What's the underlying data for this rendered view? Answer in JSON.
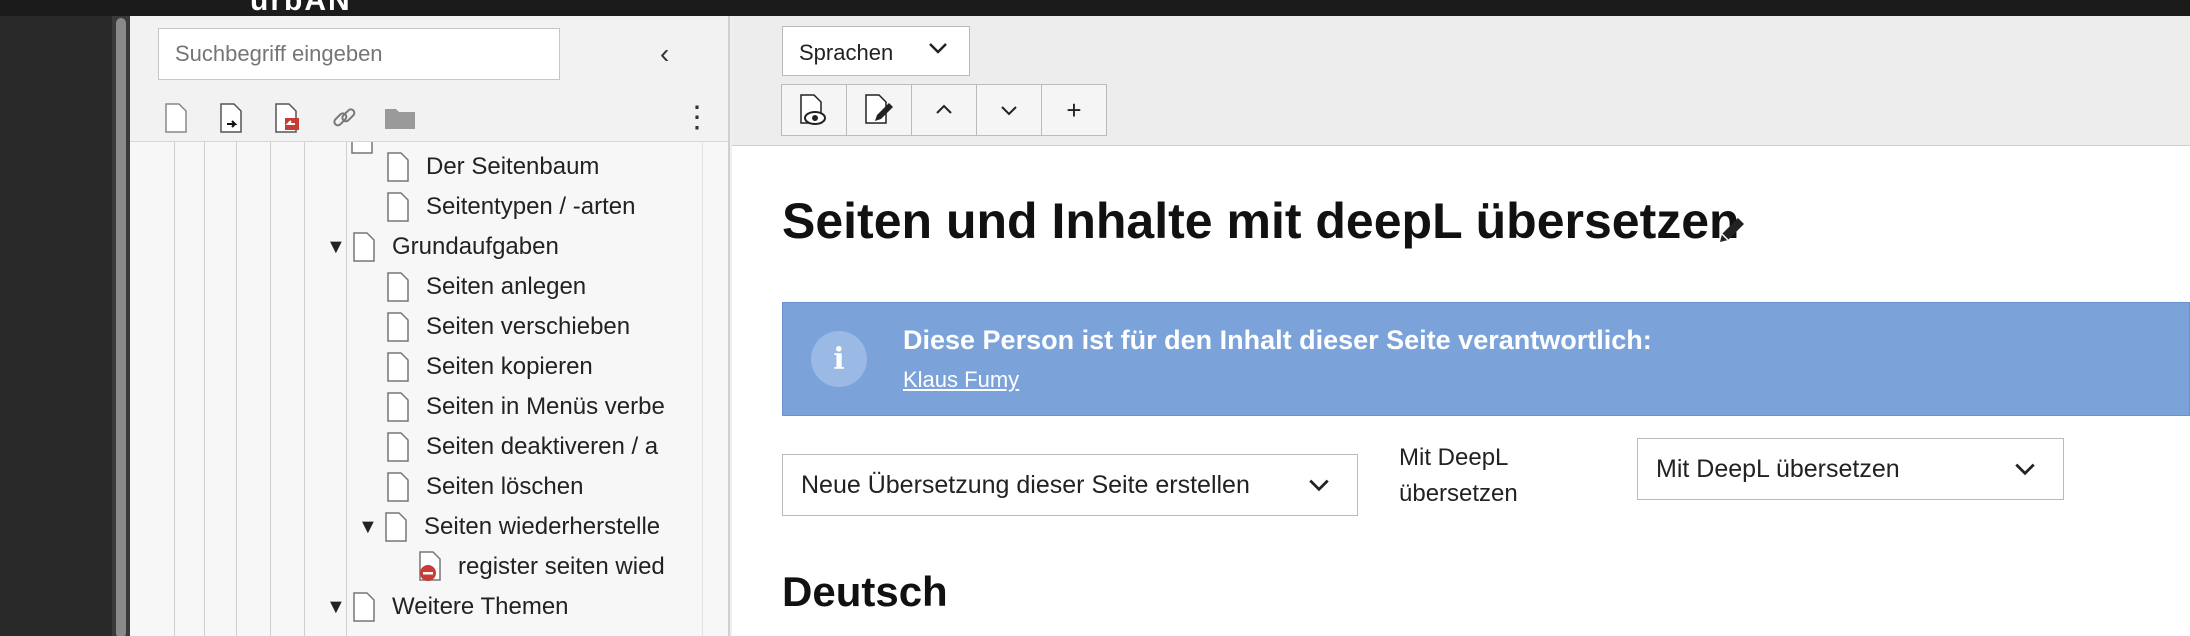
{
  "app": {
    "brand": "urbAN"
  },
  "modules": [
    {
      "name": "page-module",
      "color": "#292929"
    },
    {
      "name": "page-list-module",
      "color": "#dd8b3c"
    },
    {
      "name": "view-module",
      "color": "#c8413a"
    },
    {
      "name": "list-module",
      "color": "#c2692f"
    },
    {
      "name": "info-module",
      "color": "#6b9bd6"
    },
    {
      "name": "recycler-module",
      "color": "#5b5b5b"
    },
    {
      "name": "layout-module",
      "color": "#2f4f8c"
    }
  ],
  "tree": {
    "search_placeholder": "Suchbegriff eingeben",
    "collapse": "‹",
    "menu": "⋮",
    "nodes": [
      {
        "label": "Der Seitenbaum",
        "toggle": ""
      },
      {
        "label": "Seitentypen / -arten",
        "toggle": ""
      },
      {
        "label": "Grundaufgaben",
        "toggle": "▼"
      },
      {
        "label": "Seiten anlegen",
        "toggle": ""
      },
      {
        "label": "Seiten verschieben",
        "toggle": ""
      },
      {
        "label": "Seiten kopieren",
        "toggle": ""
      },
      {
        "label": "Seiten in Menüs verbe",
        "toggle": ""
      },
      {
        "label": "Seiten deaktiveren / a",
        "toggle": ""
      },
      {
        "label": "Seiten löschen",
        "toggle": ""
      },
      {
        "label": "Seiten wiederherstelle",
        "toggle": "▼"
      },
      {
        "label": "register seiten wied",
        "toggle": ""
      },
      {
        "label": "Weitere Themen",
        "toggle": "▼"
      }
    ]
  },
  "doc": {
    "language_select": "Sprachen",
    "buttons": {
      "up": "^",
      "down": "⌄",
      "add": "+"
    },
    "title": "Seiten und Inhalte mit deepL übersetzen",
    "info": {
      "icon": "i",
      "heading": "Diese Person ist für den Inhalt dieser Seite verantwortlich:",
      "link": "Klaus Fumy"
    },
    "translation_select": "Neue Übersetzung dieser Seite erstellen",
    "deepl_label": "Mit DeepL übersetzen",
    "deepl_select": "Mit DeepL übersetzen",
    "section_heading": "Deutsch"
  }
}
